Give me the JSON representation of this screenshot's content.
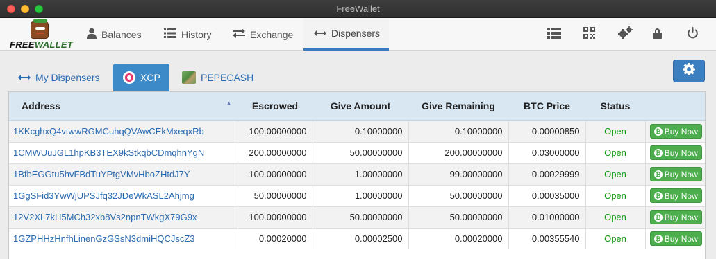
{
  "window": {
    "title": "FreeWallet"
  },
  "logo": {
    "text_free": "FREE",
    "text_wallet": "WALLET"
  },
  "nav": {
    "balances": "Balances",
    "history": "History",
    "exchange": "Exchange",
    "dispensers": "Dispensers"
  },
  "tabs": {
    "my_dispensers": "My Dispensers",
    "xcp": "XCP",
    "pepecash": "PEPECASH"
  },
  "table": {
    "headers": {
      "address": "Address",
      "escrowed": "Escrowed",
      "give_amount": "Give Amount",
      "give_remaining": "Give Remaining",
      "btc_price": "BTC Price",
      "status": "Status"
    },
    "rows": [
      {
        "address": "1KKcghxQ4vtwwRGMCuhqQVAwCEkMxeqxRb",
        "escrowed": "100.00000000",
        "give_amount": "0.10000000",
        "give_remaining": "0.10000000",
        "btc_price": "0.00000850",
        "status": "Open",
        "action": "Buy Now"
      },
      {
        "address": "1CMWUuJGL1hpKB3TEX9kStkqbCDmqhnYgN",
        "escrowed": "200.00000000",
        "give_amount": "50.00000000",
        "give_remaining": "200.00000000",
        "btc_price": "0.03000000",
        "status": "Open",
        "action": "Buy Now"
      },
      {
        "address": "1BfbEGGtu5hvFBdTuYPtgVMvHboZHtdJ7Y",
        "escrowed": "100.00000000",
        "give_amount": "1.00000000",
        "give_remaining": "99.00000000",
        "btc_price": "0.00029999",
        "status": "Open",
        "action": "Buy Now"
      },
      {
        "address": "1GgSFid3YwWjUPSJfq32JDeWkASL2Ahjmg",
        "escrowed": "50.00000000",
        "give_amount": "1.00000000",
        "give_remaining": "50.00000000",
        "btc_price": "0.00035000",
        "status": "Open",
        "action": "Buy Now"
      },
      {
        "address": "12V2XL7kH5MCh32xb8Vs2npnTWkgX79G9x",
        "escrowed": "100.00000000",
        "give_amount": "50.00000000",
        "give_remaining": "50.00000000",
        "btc_price": "0.01000000",
        "status": "Open",
        "action": "Buy Now"
      },
      {
        "address": "1GZPHHzHnfhLinenGzGSsN3dmiHQCJscZ3",
        "escrowed": "0.00020000",
        "give_amount": "0.00002500",
        "give_remaining": "0.00020000",
        "btc_price": "0.00355540",
        "status": "Open",
        "action": "Buy Now"
      }
    ]
  },
  "icons": {
    "balances": "user-icon",
    "history": "list-icon",
    "exchange": "exchange-arrows-icon",
    "dispensers": "double-arrow-icon",
    "right": [
      "list-icon",
      "qrcode-icon",
      "gears-icon",
      "lock-icon",
      "power-icon"
    ],
    "settings": "gear-icon",
    "buy": "bitcoin-icon"
  },
  "colors": {
    "accent": "#3c8ac8",
    "link": "#2a6ab0",
    "status_open": "#119a11",
    "buy_button": "#4cae4c",
    "header_bg": "#d9e7f3"
  }
}
